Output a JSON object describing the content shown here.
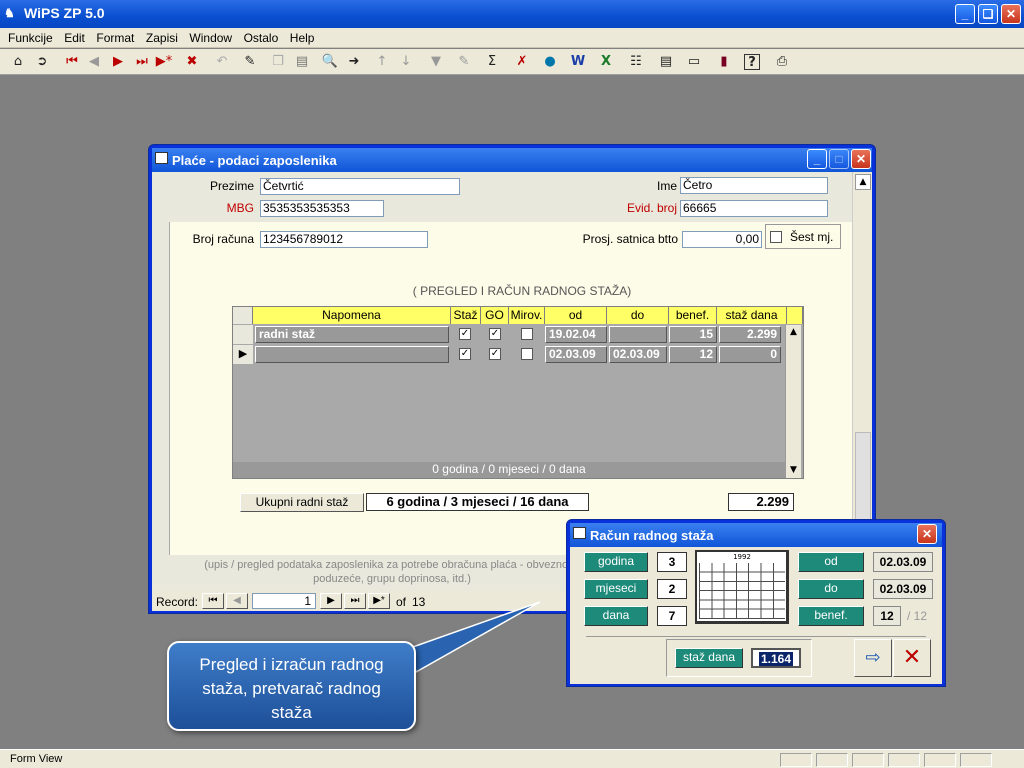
{
  "app": {
    "title": "WiPS ZP 5.0"
  },
  "menu": [
    "Funkcije",
    "Edit",
    "Format",
    "Zapisi",
    "Window",
    "Ostalo",
    "Help"
  ],
  "form": {
    "title": "Plaće - podaci zaposlenika",
    "prezime_label": "Prezime",
    "prezime": "Četvrtić",
    "ime_label": "Ime",
    "ime": "Četro",
    "mbg_label": "MBG",
    "mbg": "3535353535353",
    "evid_label": "Evid. broj",
    "evid": "66665",
    "racun_label": "Broj računa",
    "racun": "123456789012",
    "satnica_label": "Prosj. satnica btto",
    "satnica": "0,00",
    "sest_label": "Šest mj.",
    "section_title": "( PREGLED I RAČUN RADNOG STAŽA)",
    "grid": {
      "headers": [
        "Napomena",
        "Staž",
        "GO",
        "Mirov.",
        "od",
        "do",
        "benef.",
        "staž dana"
      ],
      "rows": [
        {
          "napomena": "radni staž",
          "staz": true,
          "go": true,
          "mirov": false,
          "od": "19.02.04",
          "do": "",
          "benef": "15",
          "staz_dana": "2.299"
        },
        {
          "napomena": "",
          "staz": true,
          "go": true,
          "mirov": false,
          "od": "02.03.09",
          "do": "02.03.09",
          "benef": "12",
          "staz_dana": "0"
        }
      ],
      "footer": "0 godina / 0 mjeseci / 0 dana"
    },
    "ukupni_button": "Ukupni radni staž",
    "ukupni_value": "6 godina / 3 mjeseci / 16 dana",
    "ukupni_days": "2.299",
    "hint_line1": "(upis / pregled podataka zaposlenika za potrebe obračuna plaća - obvezno je",
    "hint_line2": "poduzeće, grupu doprinosa, itd.)",
    "record_label": "Record:",
    "record_current": "1",
    "record_of": "of",
    "record_total": "13"
  },
  "dialog": {
    "title": "Račun radnog staža",
    "godina_label": "godina",
    "godina": "3",
    "mjeseci_label": "mjeseci",
    "mjeseci": "2",
    "dana_label": "dana",
    "dana": "7",
    "calendar_year": "1992",
    "od_label": "od",
    "od": "02.03.09",
    "do_label": "do",
    "do": "02.03.09",
    "benef_label": "benef.",
    "benef": "12",
    "benef_of": "/ 12",
    "staz_dana_label": "staž dana",
    "staz_dana": "1.164"
  },
  "callout": "Pregled i izračun radnog staža, pretvarač radnog staža",
  "status": "Form View"
}
